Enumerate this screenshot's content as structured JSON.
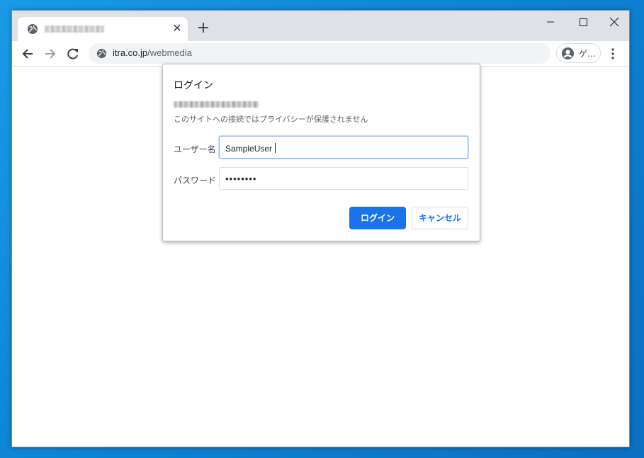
{
  "browser": {
    "tab": {
      "close_glyph": "✕",
      "icon": "globe-icon"
    },
    "new_tab_glyph": "+",
    "window_controls": {
      "minimize": "—",
      "maximize": "☐",
      "close": "✕"
    },
    "address_bar": {
      "host": "itra.co.jp",
      "path": "/webmedia",
      "icon": "globe-icon"
    },
    "profile": {
      "label": "ゲ…",
      "icon": "account-circle-icon"
    },
    "nav_icons": [
      "back-arrow-icon",
      "forward-arrow-icon",
      "reload-icon"
    ],
    "menu_icon": "kebab-menu-icon"
  },
  "login_dialog": {
    "title": "ログイン",
    "warning": "このサイトへの接続ではプライバシーが保護されません",
    "username_label": "ユーザー名",
    "username_value": "SampleUser",
    "password_label": "パスワード",
    "password_value": "••••••••",
    "login_button": "ログイン",
    "cancel_button": "キャンセル",
    "accent_color": "#1a73e8"
  }
}
